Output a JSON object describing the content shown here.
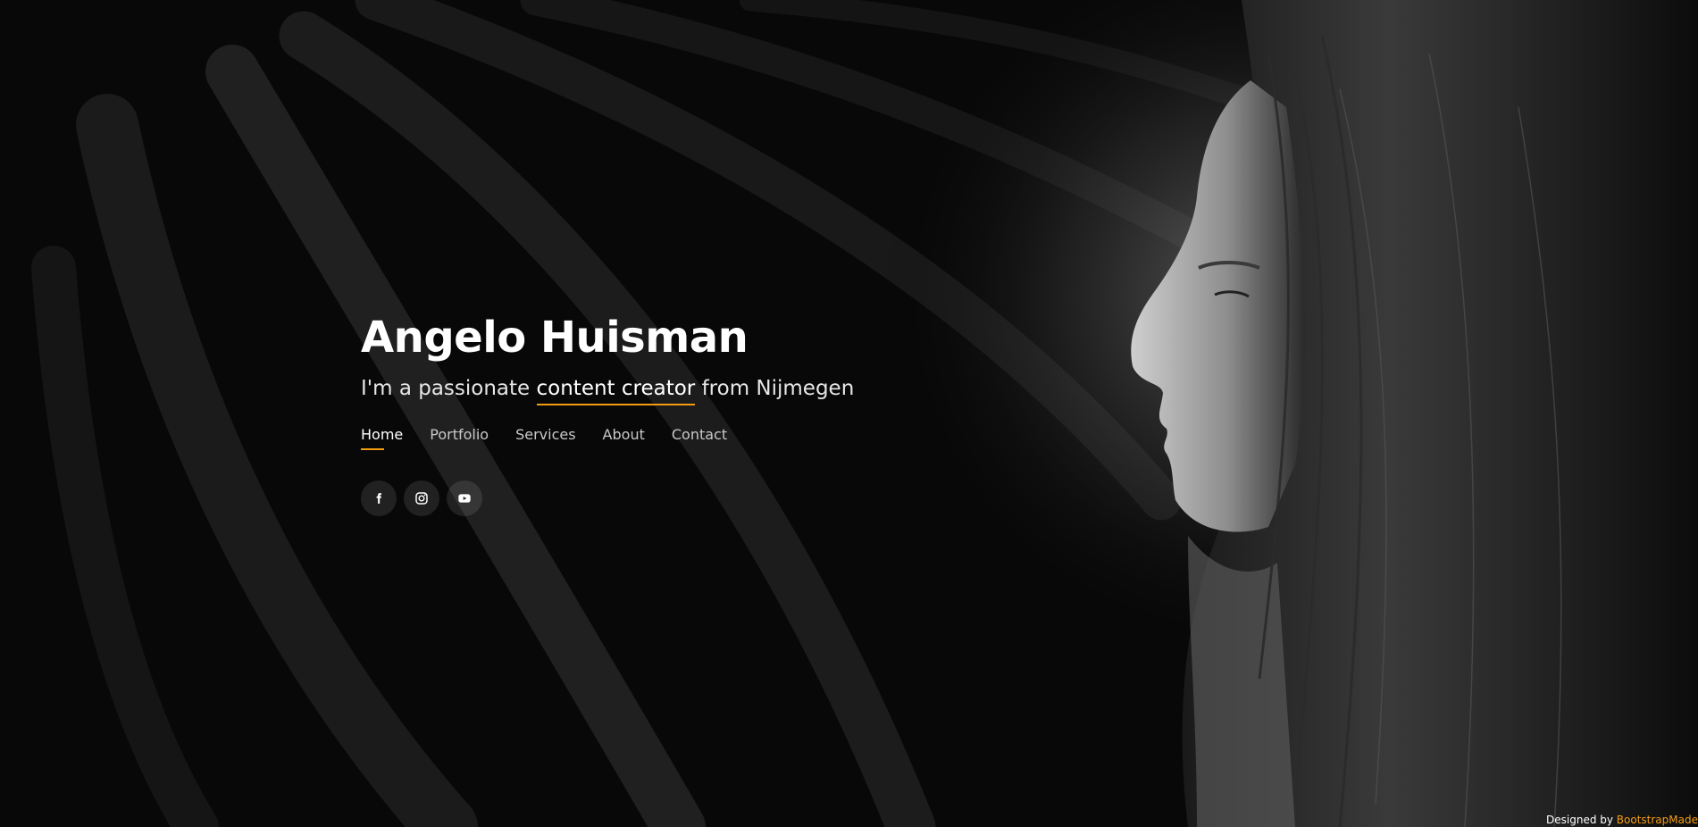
{
  "hero": {
    "title": "Angelo Huisman",
    "tagline_prefix": "I'm a passionate ",
    "tagline_typed": "content creator",
    "tagline_suffix": " from Nijmegen"
  },
  "nav": {
    "items": [
      {
        "label": "Home",
        "active": true
      },
      {
        "label": "Portfolio",
        "active": false
      },
      {
        "label": "Services",
        "active": false
      },
      {
        "label": "About",
        "active": false
      },
      {
        "label": "Contact",
        "active": false
      }
    ]
  },
  "social": {
    "items": [
      {
        "icon": "facebook-icon"
      },
      {
        "icon": "instagram-icon"
      },
      {
        "icon": "youtube-icon"
      }
    ]
  },
  "footer": {
    "credits_text": "Designed by ",
    "credits_link": "BootstrapMade"
  },
  "colors": {
    "accent": "#f39c12",
    "background": "#0a0a0a",
    "text": "#ffffff"
  }
}
